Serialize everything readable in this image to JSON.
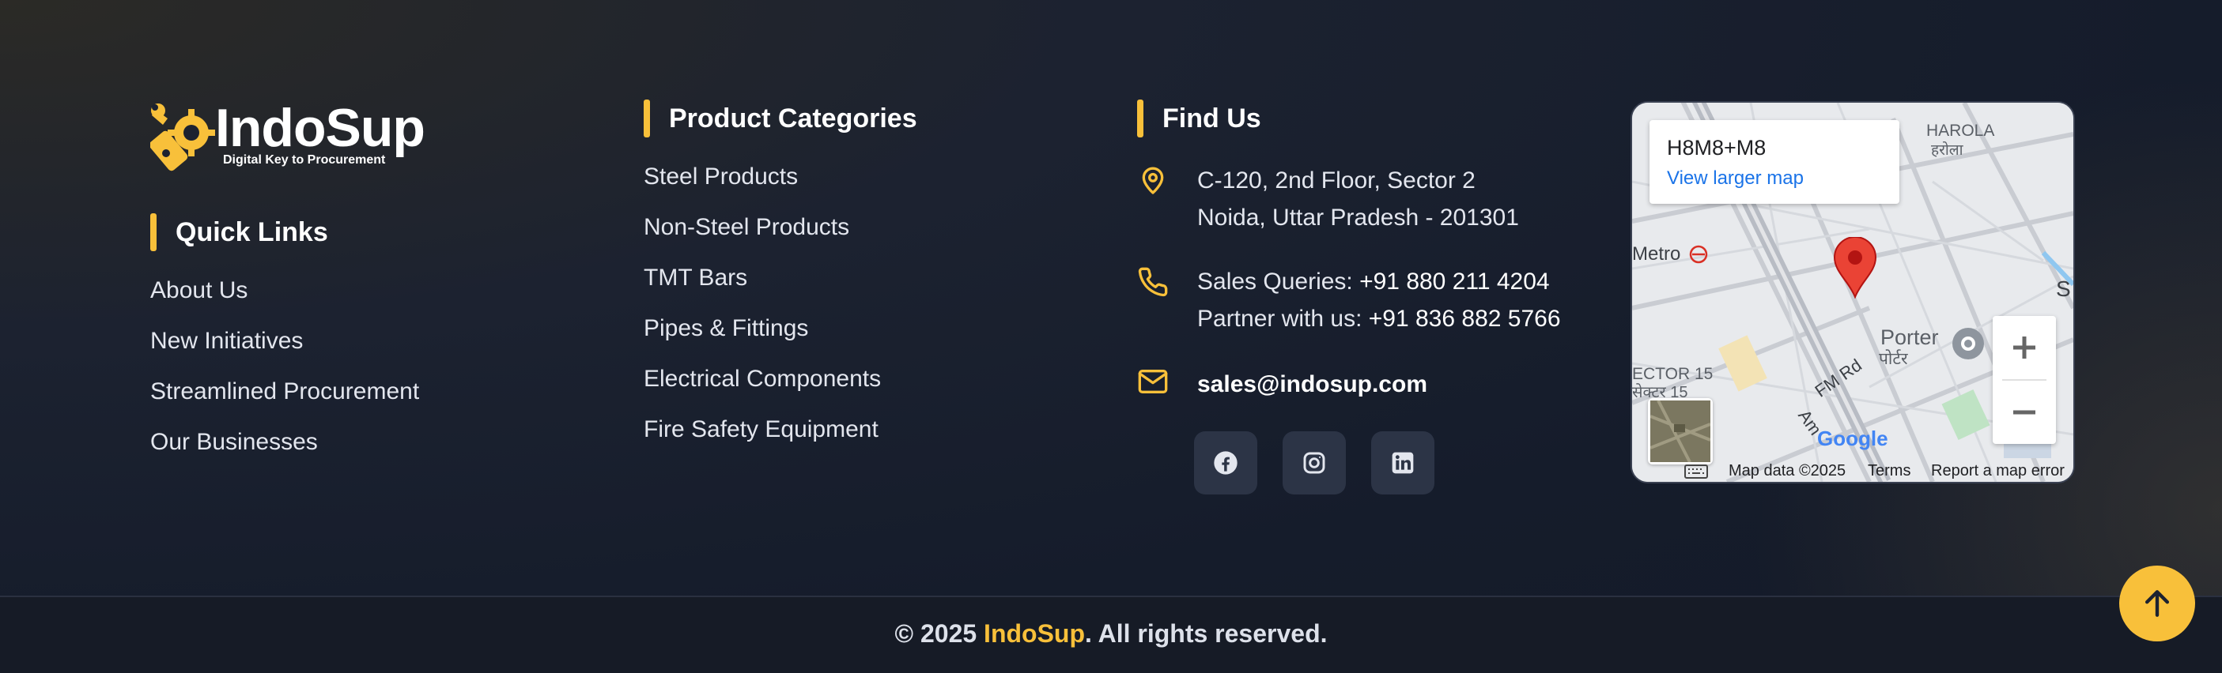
{
  "brand": {
    "name": "IndoSup",
    "tagline": "Digital Key to Procurement",
    "accent_color": "#f8c03a"
  },
  "quick_links": {
    "heading": "Quick Links",
    "items": [
      "About Us",
      "New Initiatives",
      "Streamlined Procurement",
      "Our Businesses"
    ]
  },
  "product_categories": {
    "heading": "Product Categories",
    "items": [
      "Steel Products",
      "Non-Steel Products",
      "TMT Bars",
      "Pipes & Fittings",
      "Electrical Components",
      "Fire Safety Equipment"
    ]
  },
  "find_us": {
    "heading": "Find Us",
    "address_line1": "C-120, 2nd Floor, Sector 2",
    "address_line2": "Noida, Uttar Pradesh - 201301",
    "sales_label": "Sales Queries: ",
    "sales_phone": "+91 880 211 4204",
    "partner_label": "Partner with us: ",
    "partner_phone": "+91 836 882 5766",
    "email": "sales@indosup.com",
    "social": [
      "facebook-icon",
      "instagram-icon",
      "linkedin-icon"
    ]
  },
  "map": {
    "plus_code": "H8M8+M8",
    "larger_map": "View larger map",
    "labels": {
      "harola": "HAROLA",
      "harola_hi": "हरोला",
      "metro": "Metro",
      "porter": "Porter",
      "porter_hi": "पोर्टर",
      "fm_rd": "FM Rd",
      "sector15": "ECTOR 15",
      "sector15_hi": "सेक्टर 15",
      "s_edge": "S",
      "am": "Am",
      "google": "Google"
    },
    "footer_data": "Map data ©2025",
    "footer_terms": "Terms",
    "footer_report": "Report a map error"
  },
  "footer": {
    "copyright_prefix": "© 2025 ",
    "copyright_brand": "IndoSup",
    "copyright_suffix": ". All rights reserved."
  }
}
